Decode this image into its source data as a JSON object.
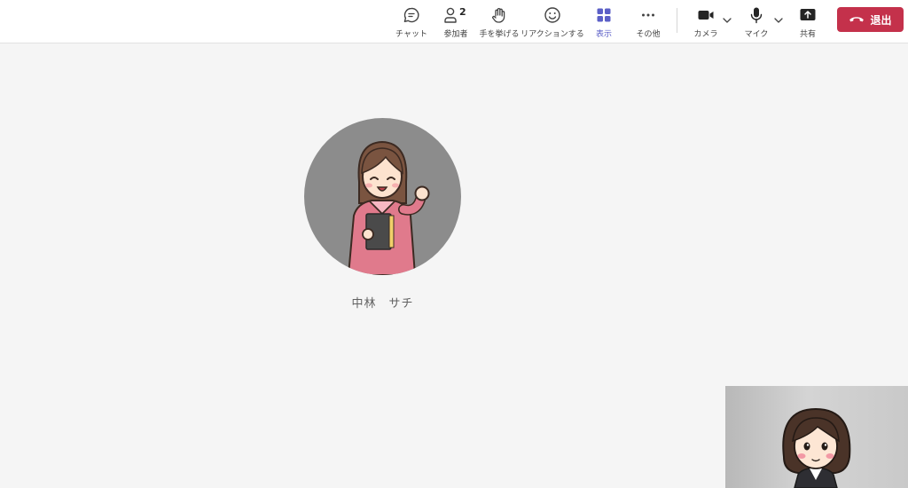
{
  "toolbar": {
    "chat_label": "チャット",
    "participants_label": "参加者",
    "participants_count": "2",
    "raise_hand_label": "手を挙げる",
    "reactions_label": "リアクションする",
    "view_label": "表示",
    "more_label": "その他",
    "camera_label": "カメラ",
    "mic_label": "マイク",
    "share_label": "共有",
    "leave_label": "退出"
  },
  "colors": {
    "accent": "#5b5fc7",
    "leave": "#c4314b",
    "avatar_bg": "#8c8c8c"
  },
  "participant": {
    "name": "中林　サチ"
  }
}
